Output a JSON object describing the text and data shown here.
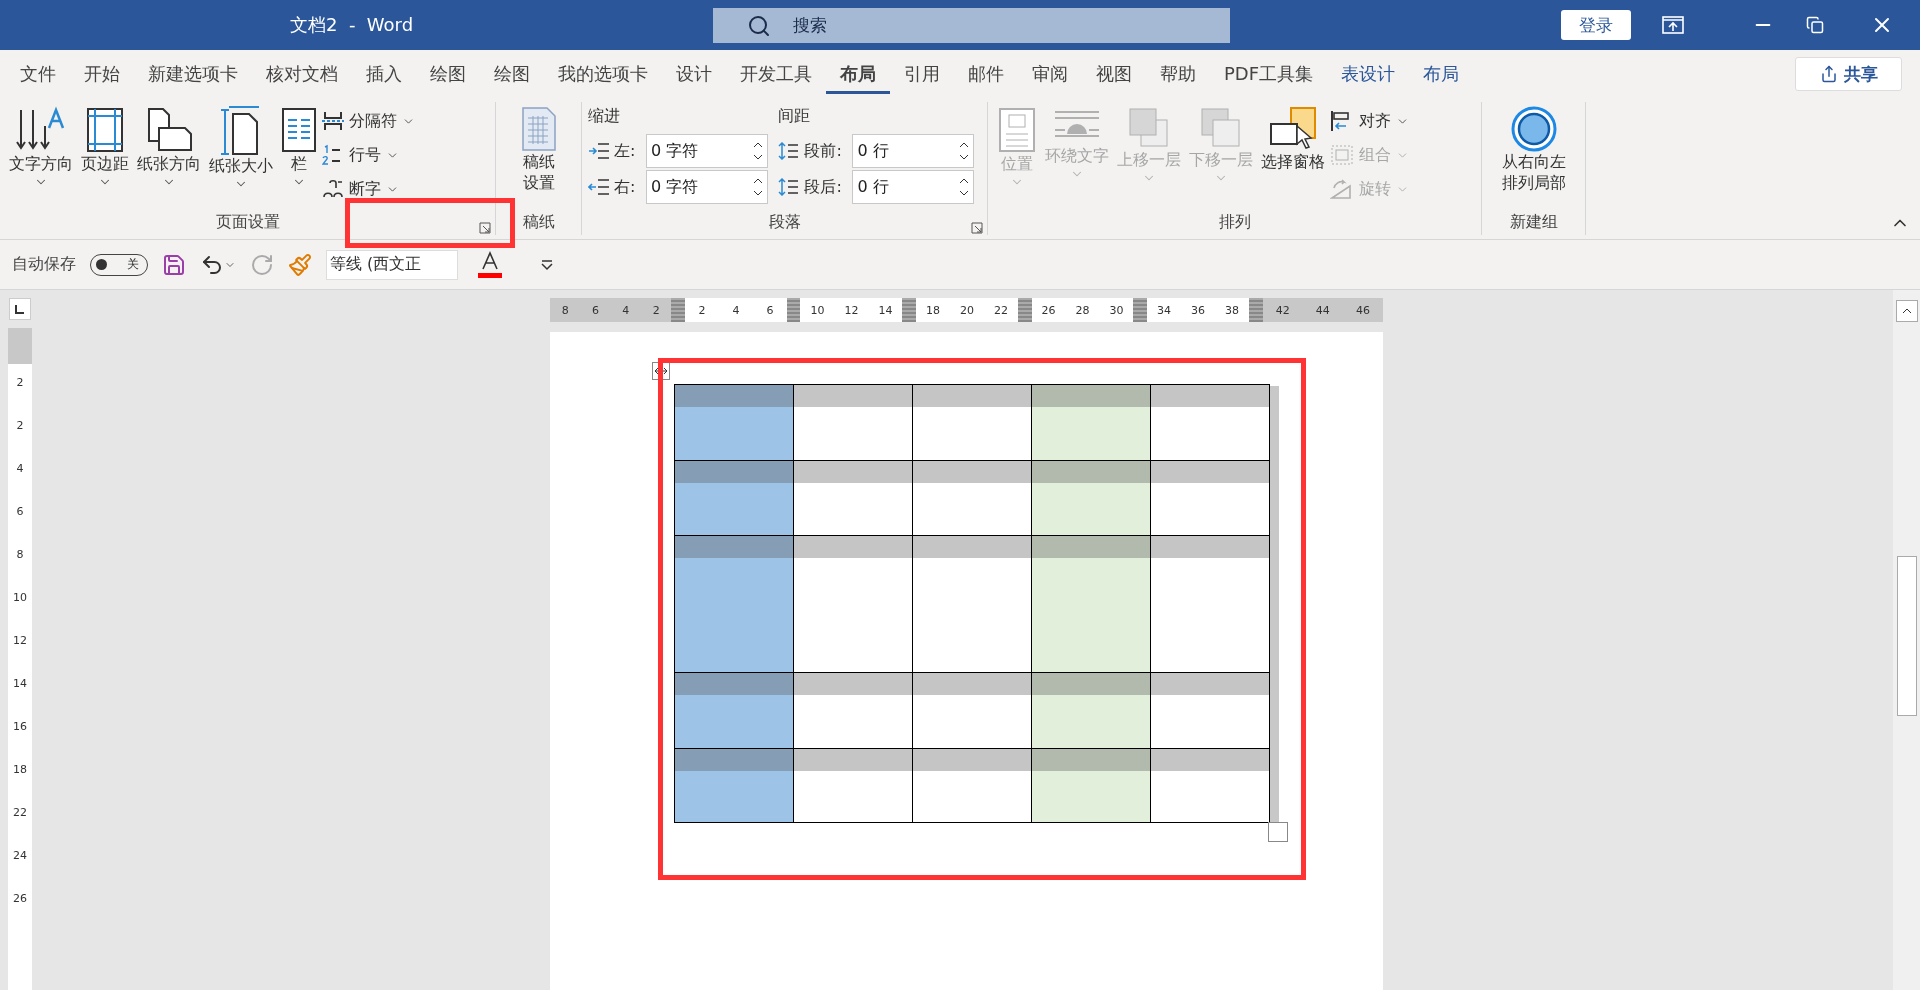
{
  "window": {
    "title": "文档2  -  Word",
    "search_placeholder": "搜索",
    "sign_in": "登录"
  },
  "tabs": [
    {
      "label": "文件",
      "selected": false,
      "contextual": false
    },
    {
      "label": "开始",
      "selected": false,
      "contextual": false
    },
    {
      "label": "新建选项卡",
      "selected": false,
      "contextual": false
    },
    {
      "label": "核对文档",
      "selected": false,
      "contextual": false
    },
    {
      "label": "插入",
      "selected": false,
      "contextual": false
    },
    {
      "label": "绘图",
      "selected": false,
      "contextual": false
    },
    {
      "label": "绘图",
      "selected": false,
      "contextual": false
    },
    {
      "label": "我的选项卡",
      "selected": false,
      "contextual": false
    },
    {
      "label": "设计",
      "selected": false,
      "contextual": false
    },
    {
      "label": "开发工具",
      "selected": false,
      "contextual": false
    },
    {
      "label": "布局",
      "selected": true,
      "contextual": false
    },
    {
      "label": "引用",
      "selected": false,
      "contextual": false
    },
    {
      "label": "邮件",
      "selected": false,
      "contextual": false
    },
    {
      "label": "审阅",
      "selected": false,
      "contextual": false
    },
    {
      "label": "视图",
      "selected": false,
      "contextual": false
    },
    {
      "label": "帮助",
      "selected": false,
      "contextual": false
    },
    {
      "label": "PDF工具集",
      "selected": false,
      "contextual": false
    },
    {
      "label": "表设计",
      "selected": false,
      "contextual": true
    },
    {
      "label": "布局",
      "selected": false,
      "contextual": true
    }
  ],
  "share": "共享",
  "page_setup": {
    "title": "页面设置",
    "large": [
      {
        "label": "文字方向",
        "disabled": false
      },
      {
        "label": "页边距",
        "disabled": false
      },
      {
        "label": "纸张方向",
        "disabled": false
      },
      {
        "label": "纸张大小",
        "disabled": false
      },
      {
        "label": "栏",
        "disabled": false
      }
    ],
    "small": [
      {
        "label": "分隔符",
        "disabled": false
      },
      {
        "label": "行号",
        "disabled": false
      },
      {
        "label": "断字",
        "disabled": false
      }
    ]
  },
  "manuscript": {
    "title": "稿纸",
    "button": "稿纸设置"
  },
  "paragraph": {
    "title": "段落",
    "indent_label": "缩进",
    "spacing_label": "间距",
    "indent": [
      {
        "label": "左:",
        "value": "0 字符"
      },
      {
        "label": "右:",
        "value": "0 字符"
      }
    ],
    "spacing": [
      {
        "label": "段前:",
        "value": "0 行"
      },
      {
        "label": "段后:",
        "value": "0 行"
      }
    ]
  },
  "arrange": {
    "title": "排列",
    "large": [
      {
        "label": "位置",
        "disabled": true
      },
      {
        "label": "环绕文字",
        "disabled": true
      },
      {
        "label": "上移一层",
        "disabled": true
      },
      {
        "label": "下移一层",
        "disabled": true
      },
      {
        "label": "选择窗格",
        "disabled": false
      }
    ],
    "small": [
      {
        "label": "对齐",
        "disabled": false
      },
      {
        "label": "组合",
        "disabled": true
      },
      {
        "label": "旋转",
        "disabled": true
      }
    ]
  },
  "new_group": {
    "title": "新建组",
    "button": "从右向左排列局部"
  },
  "quick_access": {
    "autosave_label": "自动保存",
    "autosave_on": false,
    "autosave_state": "关",
    "font": "等线 (西文正"
  },
  "ruler": {
    "segments": [
      {
        "kind": "margin",
        "labels": [
          "8",
          "6",
          "4",
          "2"
        ]
      },
      {
        "kind": "column",
        "labels": [
          "2",
          "4",
          "6"
        ]
      },
      {
        "kind": "column",
        "labels": [
          "10",
          "12",
          "14"
        ]
      },
      {
        "kind": "column",
        "labels": [
          "18",
          "20",
          "22"
        ]
      },
      {
        "kind": "column",
        "labels": [
          "26",
          "28",
          "30"
        ]
      },
      {
        "kind": "column",
        "labels": [
          "34",
          "36",
          "38"
        ]
      },
      {
        "kind": "margin",
        "labels": [
          "42",
          "44",
          "46"
        ]
      }
    ]
  },
  "vertical_ruler": {
    "labels": [
      "2",
      "2",
      "4",
      "6",
      "8",
      "10",
      "12",
      "14",
      "16",
      "18",
      "22",
      "24",
      "26"
    ]
  },
  "table": {
    "columns": [
      {
        "color": "#9dc3e6"
      },
      {
        "color": "#ffffff"
      },
      {
        "color": "#ffffff"
      },
      {
        "color": "#e2efda"
      },
      {
        "color": "#ffffff"
      }
    ]
  }
}
